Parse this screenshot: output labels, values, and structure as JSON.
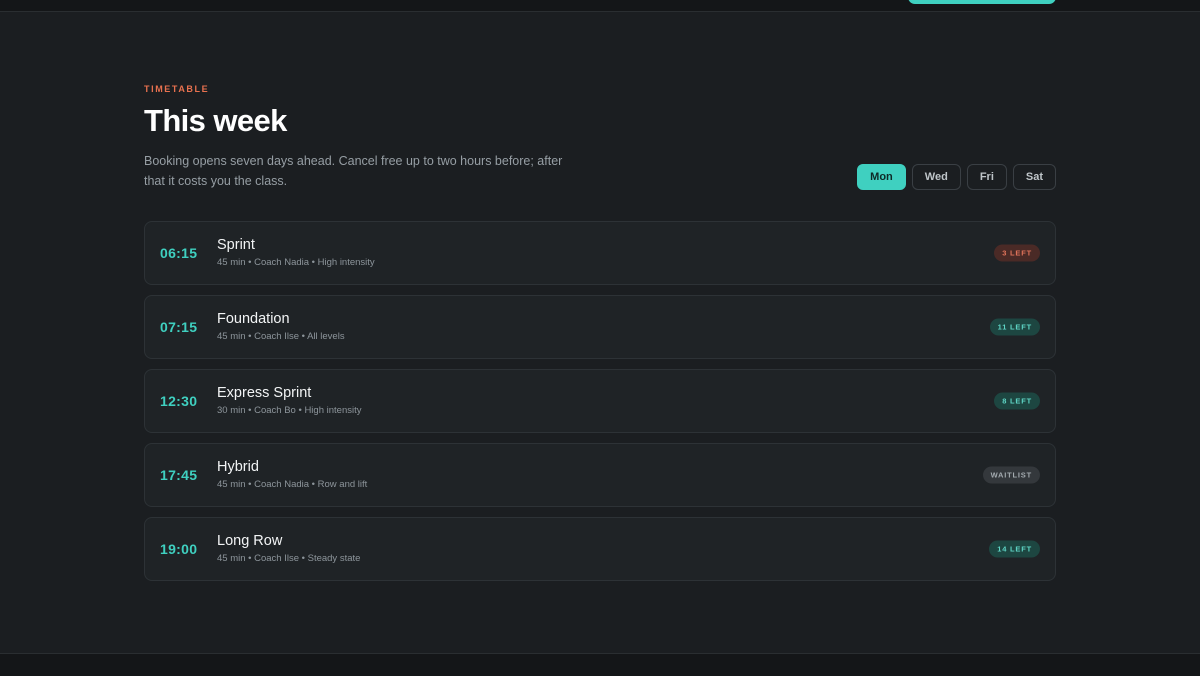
{
  "colors": {
    "accent": "#3fd0c0",
    "eyebrow": "#e8714f",
    "background": "#1b1e21"
  },
  "header": {
    "eyebrow": "TIMETABLE",
    "title": "This week",
    "description": "Booking opens seven days ahead. Cancel free up to two hours before; after that it costs you the class."
  },
  "days": [
    {
      "label": "Mon",
      "selected": true
    },
    {
      "label": "Wed",
      "selected": false
    },
    {
      "label": "Fri",
      "selected": false
    },
    {
      "label": "Sat",
      "selected": false
    }
  ],
  "classes": [
    {
      "time": "06:15",
      "name": "Sprint",
      "meta": "45 min • Coach Nadia • High intensity",
      "badge": "3 LEFT",
      "badge_status": "low"
    },
    {
      "time": "07:15",
      "name": "Foundation",
      "meta": "45 min • Coach Ilse • All levels",
      "badge": "11 LEFT",
      "badge_status": "open"
    },
    {
      "time": "12:30",
      "name": "Express Sprint",
      "meta": "30 min • Coach Bo • High intensity",
      "badge": "8 LEFT",
      "badge_status": "open"
    },
    {
      "time": "17:45",
      "name": "Hybrid",
      "meta": "45 min • Coach Nadia • Row and lift",
      "badge": "WAITLIST",
      "badge_status": "wait"
    },
    {
      "time": "19:00",
      "name": "Long Row",
      "meta": "45 min • Coach Ilse • Steady state",
      "badge": "14 LEFT",
      "badge_status": "open"
    }
  ]
}
